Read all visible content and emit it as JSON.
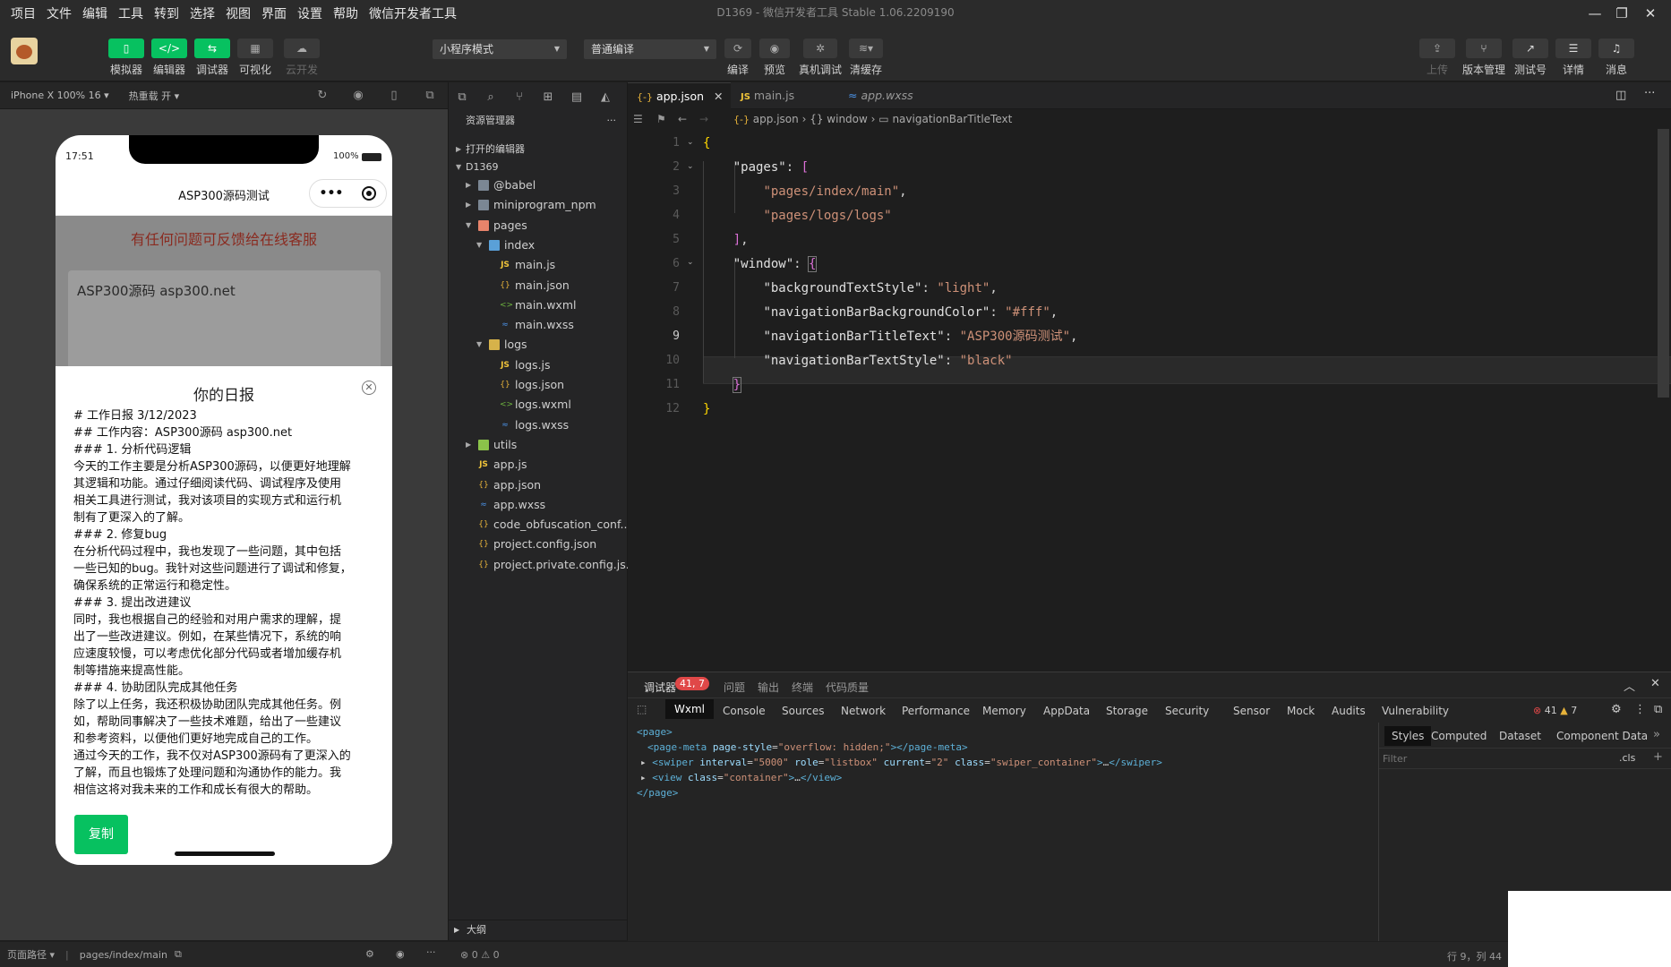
{
  "menu": [
    "项目",
    "文件",
    "编辑",
    "工具",
    "转到",
    "选择",
    "视图",
    "界面",
    "设置",
    "帮助",
    "微信开发者工具"
  ],
  "window_title": "D1369 - 微信开发者工具 Stable 1.06.2209190",
  "window_controls": {
    "min": "—",
    "restore": "❐",
    "close": "✕"
  },
  "toolbar": {
    "left": [
      {
        "label": "模拟器",
        "icon": "phone-icon"
      },
      {
        "label": "编辑器",
        "icon": "code-icon"
      },
      {
        "label": "调试器",
        "icon": "debug-icon"
      },
      {
        "label": "可视化",
        "icon": "visual-icon"
      },
      {
        "label": "云开发",
        "icon": "cloud-icon"
      }
    ],
    "mode_select": "小程序模式",
    "compile_select": "普通编译",
    "center": [
      {
        "label": "编译",
        "icon": "refresh-icon"
      },
      {
        "label": "预览",
        "icon": "eye-icon"
      },
      {
        "label": "真机调试",
        "icon": "bug-icon"
      },
      {
        "label": "清缓存",
        "icon": "layers-icon"
      }
    ],
    "right": [
      {
        "label": "上传",
        "icon": "upload-icon"
      },
      {
        "label": "版本管理",
        "icon": "branch-icon"
      },
      {
        "label": "测试号",
        "icon": "external-icon"
      },
      {
        "label": "详情",
        "icon": "menu-icon"
      },
      {
        "label": "消息",
        "icon": "bell-icon"
      }
    ]
  },
  "simulator": {
    "device": "iPhone X 100% 16 ▾",
    "hotreload": "热重载 开 ▾",
    "status_time": "17:51",
    "battery": "100%",
    "nav_title": "ASP300源码测试",
    "capsule_dots": "•••",
    "red_notice": "有任何问题可反馈给在线客服",
    "input_text": "ASP300源码 asp300.net",
    "dialog_title": "你的日报",
    "dialog_close": "✕",
    "dialog_lines": [
      "# 工作日报 3/12/2023",
      "## 工作内容：ASP300源码 asp300.net",
      "### 1. 分析代码逻辑",
      "今天的工作主要是分析ASP300源码，以便更好地理解",
      "其逻辑和功能。通过仔细阅读代码、调试程序及使用",
      "相关工具进行测试，我对该项目的实现方式和运行机",
      "制有了更深入的了解。",
      "### 2. 修复bug",
      "在分析代码过程中，我也发现了一些问题，其中包括",
      "一些已知的bug。我针对这些问题进行了调试和修复，",
      "确保系统的正常运行和稳定性。",
      "### 3. 提出改进建议",
      "同时，我也根据自己的经验和对用户需求的理解，提",
      "出了一些改进建议。例如，在某些情况下，系统的响",
      "应速度较慢，可以考虑优化部分代码或者增加缓存机",
      "制等措施来提高性能。",
      "### 4. 协助团队完成其他任务",
      "除了以上任务，我还积极协助团队完成其他任务。例",
      "如，帮助同事解决了一些技术难题，给出了一些建议",
      "和参考资料，以便他们更好地完成自己的工作。",
      "通过今天的工作，我不仅对ASP300源码有了更深入的",
      "了解，而且也锻炼了处理问题和沟通协作的能力。我",
      "相信这将对我未来的工作和成长有很大的帮助。"
    ],
    "copy_button": "复制",
    "footer_path_label": "页面路径 ▾",
    "footer_path": "pages/index/main"
  },
  "explorer": {
    "title": "资源管理器",
    "more": "···",
    "open_editors": "打开的编辑器",
    "project": "D1369",
    "tree": [
      {
        "label": "@babel",
        "depth": 1,
        "type": "folder",
        "arrow": "▶"
      },
      {
        "label": "miniprogram_npm",
        "depth": 1,
        "type": "folder",
        "arrow": "▶"
      },
      {
        "label": "pages",
        "depth": 1,
        "type": "folderp",
        "arrow": "▼"
      },
      {
        "label": "index",
        "depth": 2,
        "type": "folderb",
        "arrow": "▼"
      },
      {
        "label": "main.js",
        "depth": 3,
        "type": "js"
      },
      {
        "label": "main.json",
        "depth": 3,
        "type": "json"
      },
      {
        "label": "main.wxml",
        "depth": 3,
        "type": "wxml"
      },
      {
        "label": "main.wxss",
        "depth": 3,
        "type": "wxss"
      },
      {
        "label": "logs",
        "depth": 2,
        "type": "foldery",
        "arrow": "▼"
      },
      {
        "label": "logs.js",
        "depth": 3,
        "type": "js"
      },
      {
        "label": "logs.json",
        "depth": 3,
        "type": "json"
      },
      {
        "label": "logs.wxml",
        "depth": 3,
        "type": "wxml"
      },
      {
        "label": "logs.wxss",
        "depth": 3,
        "type": "wxss"
      },
      {
        "label": "utils",
        "depth": 1,
        "type": "folderg",
        "arrow": "▶"
      },
      {
        "label": "app.js",
        "depth": 1,
        "type": "js"
      },
      {
        "label": "app.json",
        "depth": 1,
        "type": "json"
      },
      {
        "label": "app.wxss",
        "depth": 1,
        "type": "wxss"
      },
      {
        "label": "code_obfuscation_conf...",
        "depth": 1,
        "type": "json"
      },
      {
        "label": "project.config.json",
        "depth": 1,
        "type": "json"
      },
      {
        "label": "project.private.config.js...",
        "depth": 1,
        "type": "json"
      }
    ],
    "outline": "大纲",
    "problems": "⊗ 0 ⚠ 0"
  },
  "tabs": [
    {
      "label": "app.json",
      "icon": "{-}",
      "active": true
    },
    {
      "label": "main.js",
      "icon": "JS",
      "active": false
    },
    {
      "label": "app.wxss",
      "icon": "≈",
      "active": false
    }
  ],
  "breadcrumb": [
    "app.json",
    "window",
    "navigationBarTitleText"
  ],
  "code": {
    "line_numbers": [
      "1",
      "2",
      "3",
      "4",
      "5",
      "6",
      "7",
      "8",
      "9",
      "10",
      "11",
      "12"
    ],
    "current_line": "9"
  },
  "devtools": {
    "top_tabs": [
      "调试器",
      "问题",
      "输出",
      "终端",
      "代码质量"
    ],
    "badge": "41, 7",
    "panel_tabs": [
      "Wxml",
      "Console",
      "Sources",
      "Network",
      "Performance",
      "Memory",
      "AppData",
      "Storage",
      "Security",
      "Sensor",
      "Mock",
      "Audits",
      "Vulnerability"
    ],
    "errors": "41",
    "warnings": "7",
    "style_tabs": [
      "Styles",
      "Computed",
      "Dataset",
      "Component Data"
    ],
    "filter_placeholder": "Filter",
    "cls": ".cls",
    "plus": "+"
  },
  "status": {
    "position": "行 9，列 44"
  },
  "colors": {
    "accent": "#07c160",
    "error": "#e04848",
    "string": "#ce9178"
  }
}
